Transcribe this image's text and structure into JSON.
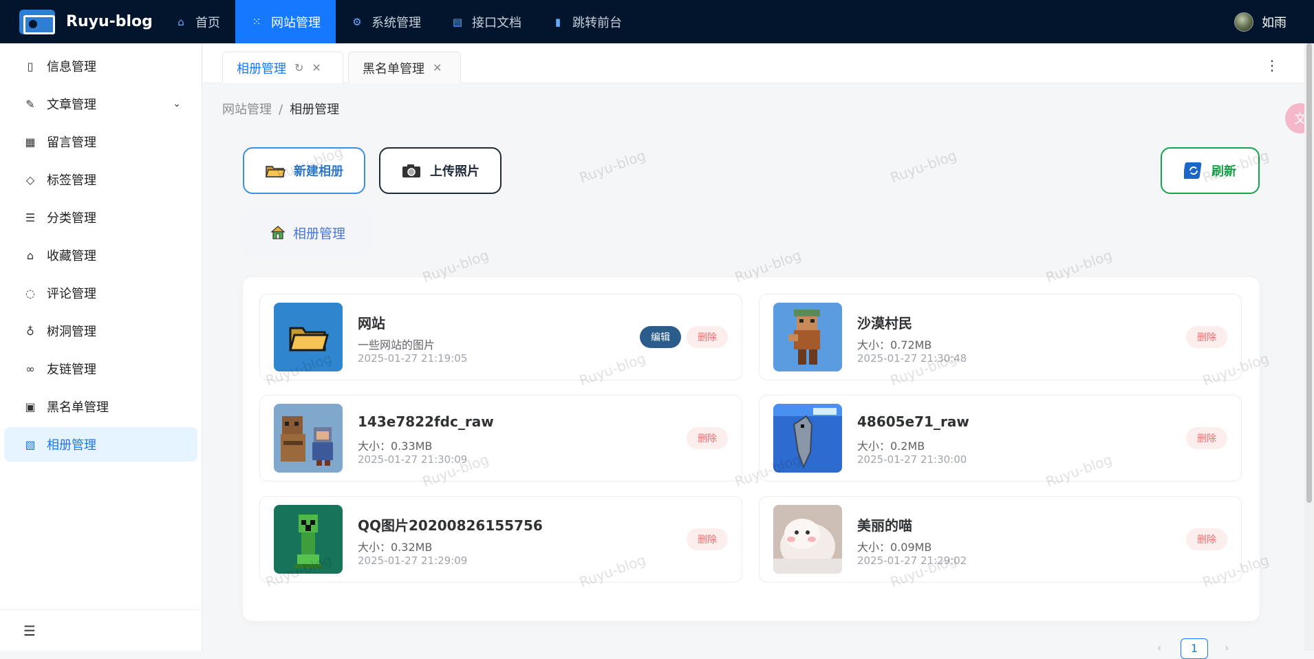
{
  "brand": {
    "title": "Ruyu-blog"
  },
  "topnav": [
    {
      "label": "首页",
      "icon": "home-icon"
    },
    {
      "label": "网站管理",
      "icon": "grid-icon"
    },
    {
      "label": "系统管理",
      "icon": "gear-icon"
    },
    {
      "label": "接口文档",
      "icon": "document-icon"
    },
    {
      "label": "跳转前台",
      "icon": "bookmark-icon"
    }
  ],
  "user": {
    "name": "如雨"
  },
  "sidebar": {
    "items": [
      {
        "label": "信息管理",
        "icon": "book-icon"
      },
      {
        "label": "文章管理",
        "icon": "edit-icon"
      },
      {
        "label": "留言管理",
        "icon": "calendar-icon"
      },
      {
        "label": "标签管理",
        "icon": "tag-icon"
      },
      {
        "label": "分类管理",
        "icon": "list-icon"
      },
      {
        "label": "收藏管理",
        "icon": "inbox-icon"
      },
      {
        "label": "评论管理",
        "icon": "chat-icon"
      },
      {
        "label": "树洞管理",
        "icon": "bulb-icon"
      },
      {
        "label": "友链管理",
        "icon": "link-icon"
      },
      {
        "label": "黑名单管理",
        "icon": "file-lock-icon"
      },
      {
        "label": "相册管理",
        "icon": "image-icon"
      }
    ],
    "active_index": 10
  },
  "tabs": [
    {
      "label": "相册管理",
      "active": true
    },
    {
      "label": "黑名单管理",
      "active": false
    }
  ],
  "breadcrumb": {
    "parent": "网站管理",
    "separator": "/",
    "current": "相册管理"
  },
  "toolbar": {
    "new_album_label": "新建相册",
    "upload_label": "上传照片",
    "refresh_label": "刷新"
  },
  "album_tab": {
    "label": "相册管理"
  },
  "cards": [
    {
      "title": "网站",
      "subtitle": "一些网站的图片",
      "date": "2025-01-27 21:19:05",
      "edit_label": "编辑",
      "delete_label": "删除",
      "kind": "folder"
    },
    {
      "title": "沙漠村民",
      "subtitle": "大小：0.72MB",
      "date": "2025-01-27 21:30:48",
      "delete_label": "删除",
      "kind": "image"
    },
    {
      "title": "143e7822fdc_raw",
      "subtitle": "大小：0.33MB",
      "date": "2025-01-27 21:30:09",
      "delete_label": "删除",
      "kind": "image"
    },
    {
      "title": "48605e71_raw",
      "subtitle": "大小：0.2MB",
      "date": "2025-01-27 21:30:00",
      "delete_label": "删除",
      "kind": "image"
    },
    {
      "title": "QQ图片20200826155756",
      "subtitle": "大小：0.32MB",
      "date": "2025-01-27 21:29:09",
      "delete_label": "删除",
      "kind": "image"
    },
    {
      "title": "美丽的喵",
      "subtitle": "大小：0.09MB",
      "date": "2025-01-27 21:29:02",
      "delete_label": "删除",
      "kind": "image"
    }
  ],
  "watermark": "Ruyu-blog",
  "pagination": {
    "current": "1"
  },
  "colors": {
    "topbar": "#02152c",
    "accent": "#1677ff",
    "danger": "#f56c6c",
    "success": "#16a34a"
  }
}
